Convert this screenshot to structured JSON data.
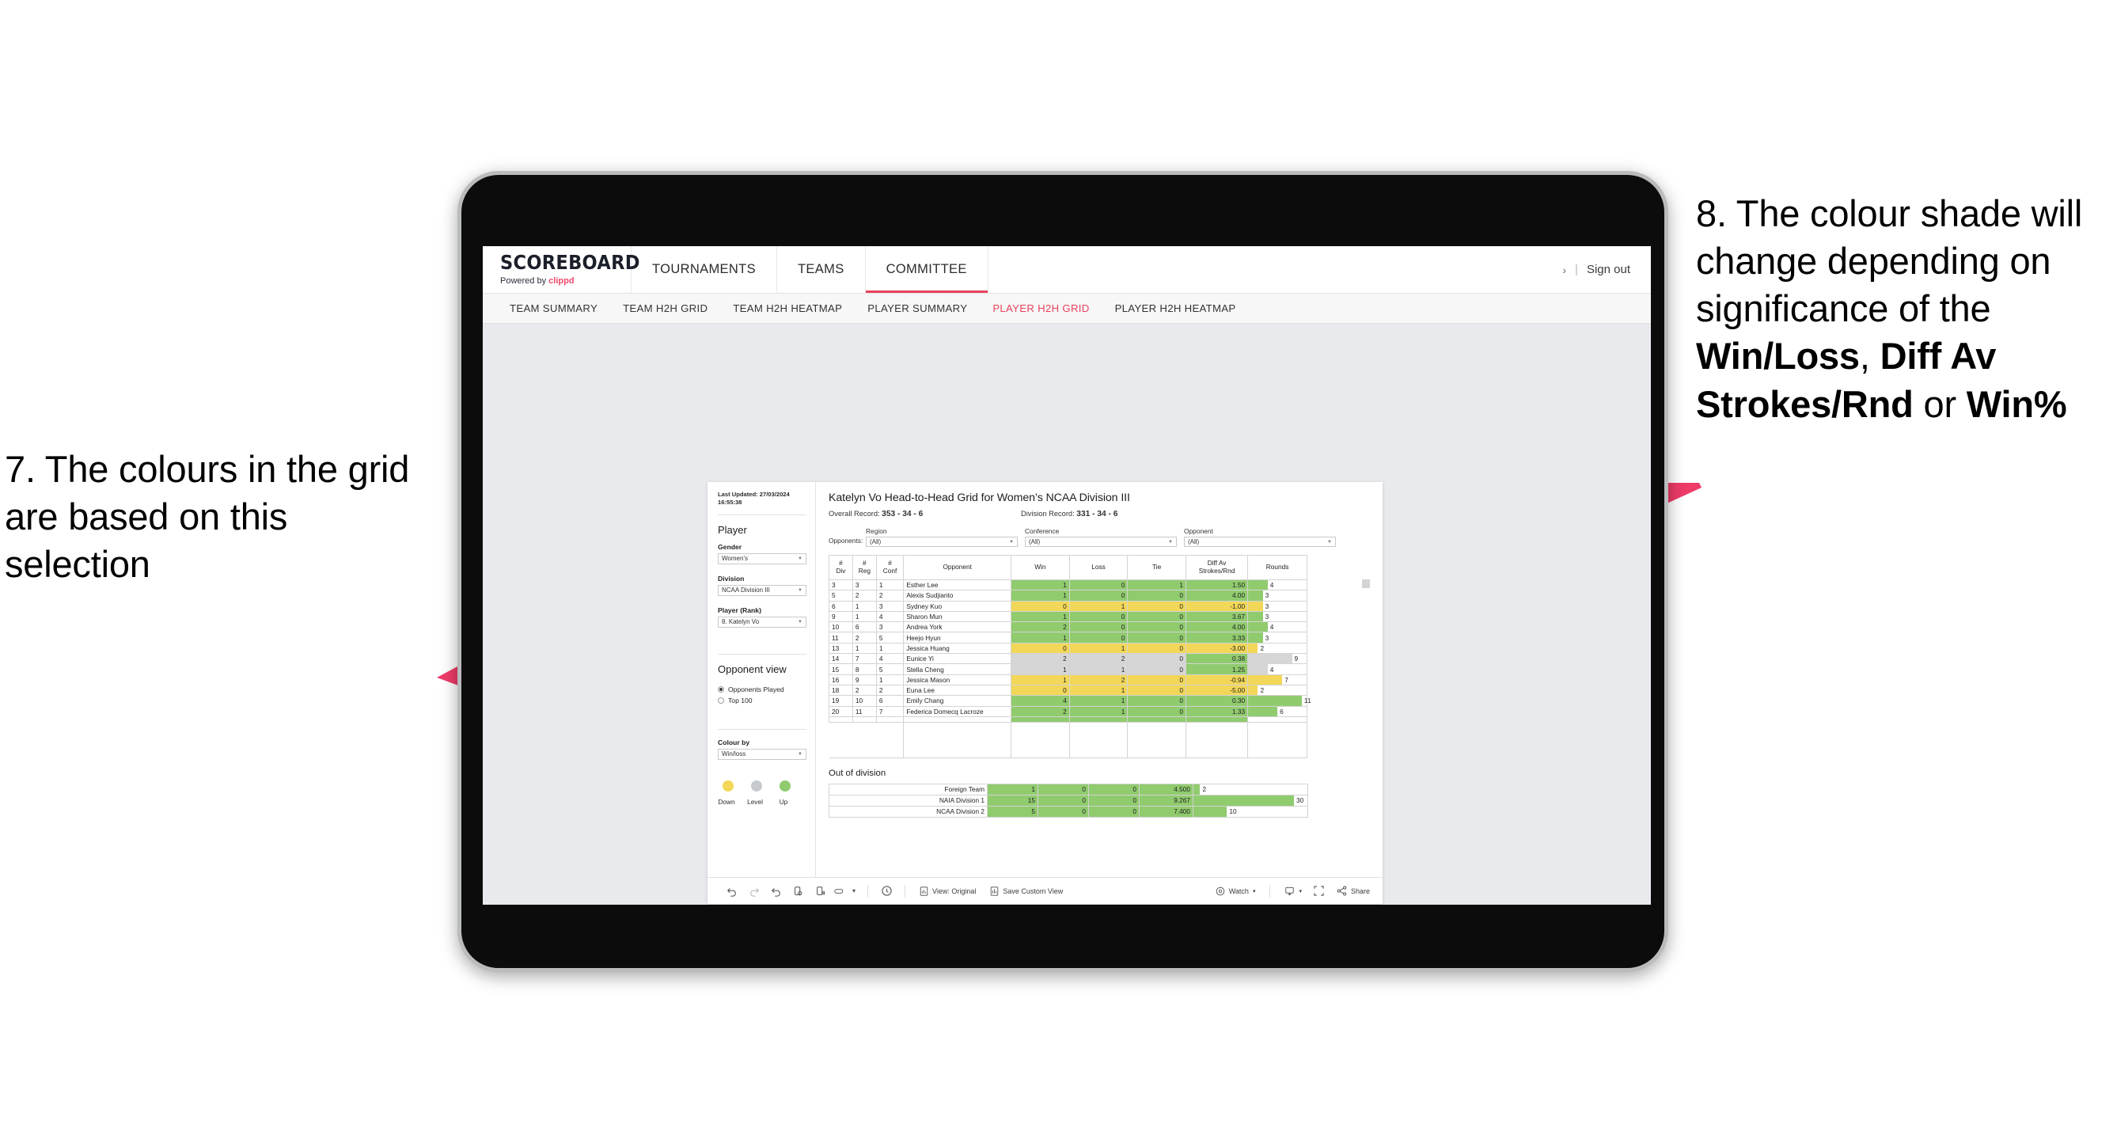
{
  "annotations": {
    "left": "7. The colours in the grid are based on this selection",
    "right_pre": "8. The colour shade will change depending on significance of the ",
    "right_b1": "Win/Loss",
    "right_mid1": ", ",
    "right_b2": "Diff Av Strokes/Rnd",
    "right_mid2": " or ",
    "right_b3": "Win%",
    "arrow_color": "#ee3b68"
  },
  "appbar": {
    "brand_title": "SCOREBOARD",
    "brand_sub_prefix": "Powered by ",
    "brand_sub_brand": "clippd",
    "nav": [
      {
        "label": "TOURNAMENTS",
        "active": false
      },
      {
        "label": "TEAMS",
        "active": false
      },
      {
        "label": "COMMITTEE",
        "active": true
      }
    ],
    "chevron": "›",
    "separator": "|",
    "signout": "Sign out"
  },
  "subnav": {
    "items": [
      {
        "label": "TEAM SUMMARY",
        "active": false
      },
      {
        "label": "TEAM H2H GRID",
        "active": false
      },
      {
        "label": "TEAM H2H HEATMAP",
        "active": false
      },
      {
        "label": "PLAYER SUMMARY",
        "active": false
      },
      {
        "label": "PLAYER H2H GRID",
        "active": true
      },
      {
        "label": "PLAYER H2H HEATMAP",
        "active": false
      }
    ]
  },
  "pane": {
    "last_updated_label": "Last Updated: ",
    "last_updated_value": "27/03/2024 16:55:38",
    "player_heading": "Player",
    "gender_label": "Gender",
    "gender_value": "Women’s",
    "division_label": "Division",
    "division_value": "NCAA Division III",
    "player_rank_label": "Player (Rank)",
    "player_rank_value": "8. Katelyn Vo",
    "opponent_view_heading": "Opponent view",
    "radio_opponents_played": "Opponents Played",
    "radio_top100": "Top 100",
    "colour_by_label": "Colour by",
    "colour_by_value": "Win/loss",
    "legend": [
      {
        "label": "Down",
        "color": "#f2d758"
      },
      {
        "label": "Level",
        "color": "#c6c9cd"
      },
      {
        "label": "Up",
        "color": "#90cb6e"
      }
    ]
  },
  "content": {
    "title": "Katelyn Vo Head-to-Head Grid for Women’s NCAA Division III",
    "overall_record_label": "Overall Record: ",
    "overall_record_value": "353 -  34 - 6",
    "division_record_label": "Division Record: ",
    "division_record_value": "331 -  34 - 6",
    "opponents_label": "Opponents:",
    "filters": [
      {
        "caption": "Region",
        "value": "(All)"
      },
      {
        "caption": "Conference",
        "value": "(All)"
      },
      {
        "caption": "Opponent",
        "value": "(All)"
      }
    ],
    "out_of_division_title": "Out of division"
  },
  "chart_data": {
    "type": "table",
    "title": "Katelyn Vo Head-to-Head Grid for Women’s NCAA Division III",
    "columns": [
      "# Div",
      "# Reg",
      "# Conf",
      "Opponent",
      "Win",
      "Loss",
      "Tie",
      "Diff Av Strokes/Rnd",
      "Rounds"
    ],
    "column_header_lines": [
      [
        "#",
        "Div"
      ],
      [
        "#",
        "Reg"
      ],
      [
        "#",
        "Conf"
      ],
      [
        "Opponent"
      ],
      [
        "Win"
      ],
      [
        "Loss"
      ],
      [
        "Tie"
      ],
      [
        "Diff Av",
        "Strokes/Rnd"
      ],
      [
        "Rounds"
      ]
    ],
    "rounds_max": 12,
    "colors": {
      "up": "#90cb6e",
      "down": "#f2d758",
      "level": "#d6d6d6"
    },
    "rows": [
      {
        "div": "3",
        "reg": "3",
        "conf": "1",
        "opponent": "Esther Lee",
        "win": "1",
        "loss": "0",
        "tie": "1",
        "diff": "1.50",
        "rounds": "4",
        "state": "up"
      },
      {
        "div": "5",
        "reg": "2",
        "conf": "2",
        "opponent": "Alexis Sudjianto",
        "win": "1",
        "loss": "0",
        "tie": "0",
        "diff": "4.00",
        "rounds": "3",
        "state": "up"
      },
      {
        "div": "6",
        "reg": "1",
        "conf": "3",
        "opponent": "Sydney Kuo",
        "win": "0",
        "loss": "1",
        "tie": "0",
        "diff": "-1.00",
        "rounds": "3",
        "state": "down"
      },
      {
        "div": "9",
        "reg": "1",
        "conf": "4",
        "opponent": "Sharon Mun",
        "win": "1",
        "loss": "0",
        "tie": "0",
        "diff": "3.67",
        "rounds": "3",
        "state": "up"
      },
      {
        "div": "10",
        "reg": "6",
        "conf": "3",
        "opponent": "Andrea York",
        "win": "2",
        "loss": "0",
        "tie": "0",
        "diff": "4.00",
        "rounds": "4",
        "state": "up"
      },
      {
        "div": "11",
        "reg": "2",
        "conf": "5",
        "opponent": "Heejo Hyun",
        "win": "1",
        "loss": "0",
        "tie": "0",
        "diff": "3.33",
        "rounds": "3",
        "state": "up"
      },
      {
        "div": "13",
        "reg": "1",
        "conf": "1",
        "opponent": "Jessica Huang",
        "win": "0",
        "loss": "1",
        "tie": "0",
        "diff": "-3.00",
        "rounds": "2",
        "state": "down"
      },
      {
        "div": "14",
        "reg": "7",
        "conf": "4",
        "opponent": "Eunice Yi",
        "win": "2",
        "loss": "2",
        "tie": "0",
        "diff": "0.38",
        "rounds": "9",
        "state": "level",
        "diff_state": "up"
      },
      {
        "div": "15",
        "reg": "8",
        "conf": "5",
        "opponent": "Stella Cheng",
        "win": "1",
        "loss": "1",
        "tie": "0",
        "diff": "1.25",
        "rounds": "4",
        "state": "level",
        "diff_state": "up"
      },
      {
        "div": "16",
        "reg": "9",
        "conf": "1",
        "opponent": "Jessica Mason",
        "win": "1",
        "loss": "2",
        "tie": "0",
        "diff": "-0.94",
        "rounds": "7",
        "state": "down"
      },
      {
        "div": "18",
        "reg": "2",
        "conf": "2",
        "opponent": "Euna Lee",
        "win": "0",
        "loss": "1",
        "tie": "0",
        "diff": "-5.00",
        "rounds": "2",
        "state": "down"
      },
      {
        "div": "19",
        "reg": "10",
        "conf": "6",
        "opponent": "Emily Chang",
        "win": "4",
        "loss": "1",
        "tie": "0",
        "diff": "0.30",
        "rounds": "11",
        "state": "up"
      },
      {
        "div": "20",
        "reg": "11",
        "conf": "7",
        "opponent": "Federica Domecq Lacroze",
        "win": "2",
        "loss": "1",
        "tie": "0",
        "diff": "1.33",
        "rounds": "6",
        "state": "up"
      }
    ],
    "out_of_division": {
      "rounds_max": 34,
      "rows": [
        {
          "name": "Foreign Team",
          "win": "1",
          "loss": "0",
          "tie": "0",
          "diff": "4.500",
          "rounds": "2",
          "state": "up"
        },
        {
          "name": "NAIA Division 1",
          "win": "15",
          "loss": "0",
          "tie": "0",
          "diff": "9.267",
          "rounds": "30",
          "state": "up"
        },
        {
          "name": "NCAA Division 2",
          "win": "5",
          "loss": "0",
          "tie": "0",
          "diff": "7.400",
          "rounds": "10",
          "state": "up"
        }
      ]
    }
  },
  "toolbar": {
    "icons": [
      "undo-icon",
      "redo-icon",
      "revert-icon",
      "refresh-data-icon",
      "pause-updates-icon",
      "highlight-icon"
    ],
    "highlight_caret": "▾",
    "alert_icon": "alerts-icon",
    "view_label": "View: Original",
    "save_label": "Save Custom View",
    "watch_label": "Watch",
    "watch_caret": "▾",
    "download_caret": "▾",
    "fullscreen_icon": "fullscreen-icon",
    "share_label": "Share"
  }
}
